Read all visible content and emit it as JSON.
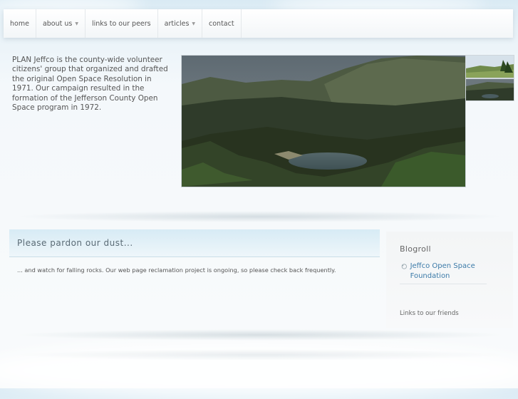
{
  "nav": {
    "items": [
      {
        "label": "home",
        "has_dropdown": false
      },
      {
        "label": "about us",
        "has_dropdown": true
      },
      {
        "label": "links to our peers",
        "has_dropdown": false
      },
      {
        "label": "articles",
        "has_dropdown": true
      },
      {
        "label": "contact",
        "has_dropdown": false
      }
    ],
    "caret": "▼"
  },
  "intro": {
    "text": "PLAN Jeffco is the county-wide volunteer citizens' group that organized and drafted the original Open Space Resolution in 1971. Our campaign resulted in the formation of the Jefferson County Open Space program in 1972."
  },
  "slideshow": {
    "main_image": "mountain-lake-landscape",
    "thumbnails": [
      "meadow-trees-landscape",
      "mountain-lake-landscape"
    ]
  },
  "post": {
    "title": "Please pardon our dust...",
    "body": "... and watch for falling rocks. Our web page reclamation project is ongoing, so please check back frequently."
  },
  "sidebar": {
    "blogroll_title": "Blogroll",
    "links": [
      {
        "label": "Jeffco Open Space Foundation",
        "icon": "circular-arrow-icon"
      }
    ],
    "friends_label": "Links to our friends"
  },
  "colors": {
    "link": "#3b7aa8",
    "header_band": "#d7ebf5",
    "text": "#555555"
  }
}
